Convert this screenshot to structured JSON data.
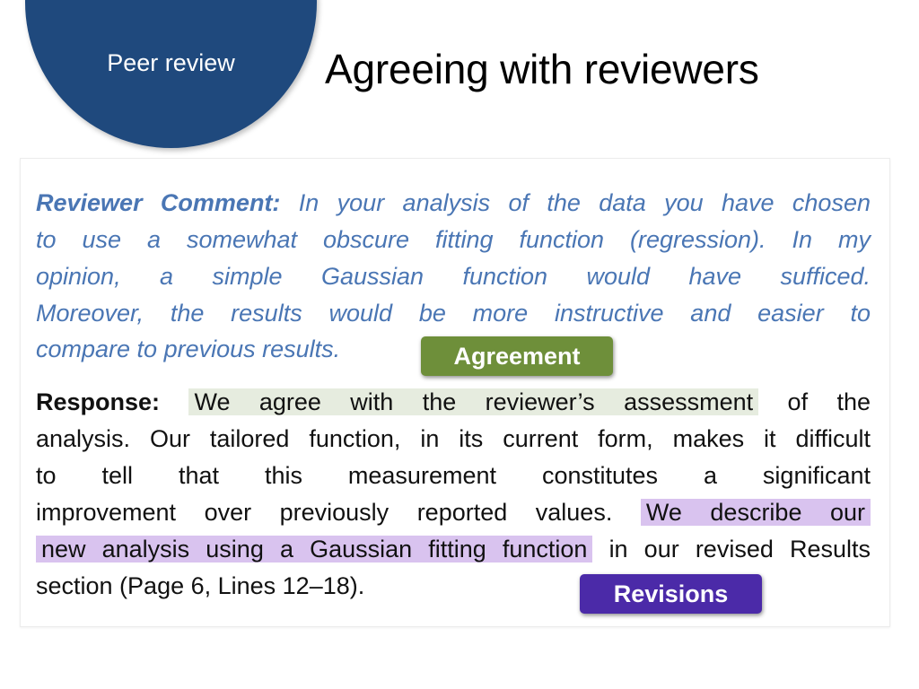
{
  "header": {
    "section_label": "Peer review",
    "title": "Agreeing with reviewers"
  },
  "colors": {
    "circle": "#1f497d",
    "comment_text": "#4a76b4",
    "agreement_tag": "#6e8f3a",
    "agreement_highlight": "#e6ecdf",
    "revisions_tag": "#4b2aa8",
    "revisions_highlight": "#d9c3ef"
  },
  "comment": {
    "label": "Reviewer Comment:",
    "lines": [
      "In your analysis of the data you have chosen",
      "to use a somewhat obscure fitting function (regression).  In my",
      "opinion, a simple Gaussian function would have sufficed.",
      "Moreover, the results would be more instructive and easier to",
      "compare to previous results."
    ]
  },
  "response": {
    "label": "Response:",
    "agreement_text": "We agree with the reviewer’s assessment",
    "line1_rest": "of the",
    "line2": "analysis. Our tailored function, in its current form, makes it difficult",
    "line3": "to tell that this measurement constitutes a significant",
    "line4_start": "improvement over previously reported values.",
    "revision_part1": "We describe our",
    "revision_part2": "new analysis using a Gaussian fitting function",
    "line5_rest": "in our revised Results",
    "line6": "section (Page 6, Lines 12–18)."
  },
  "tags": {
    "agreement": "Agreement",
    "revisions": "Revisions"
  }
}
